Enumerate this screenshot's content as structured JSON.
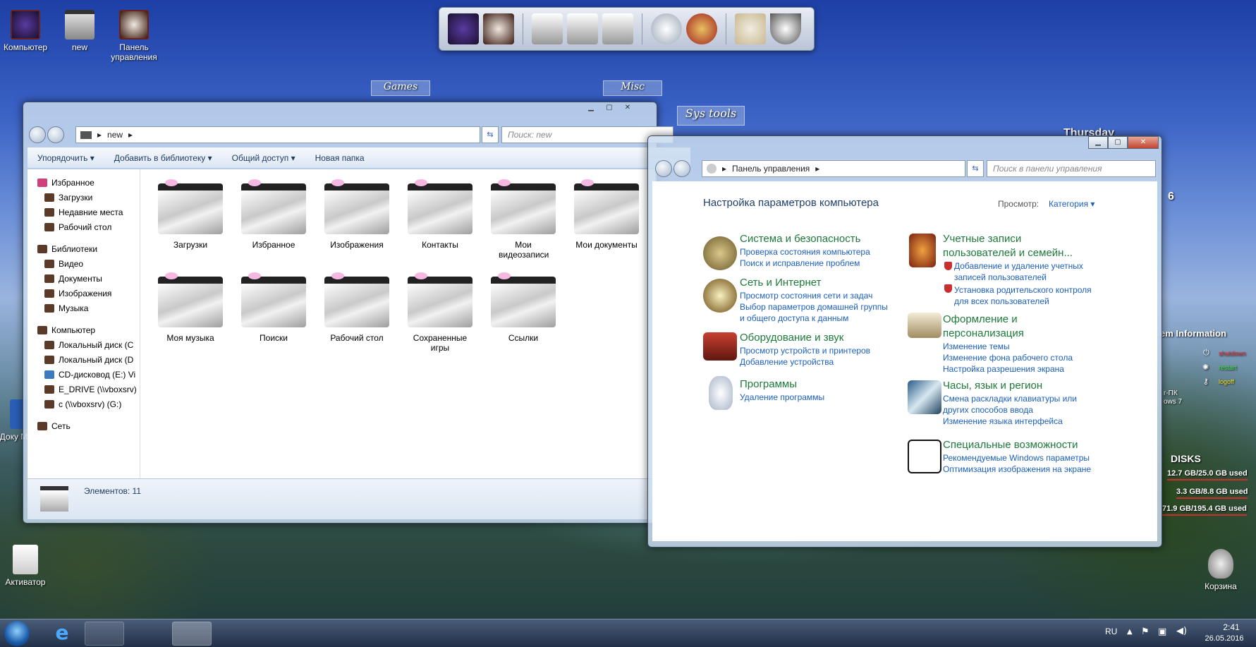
{
  "desktop_icons": [
    {
      "label": "Компьютер"
    },
    {
      "label": "new"
    },
    {
      "label": "Панель управления"
    },
    {
      "label": "Доку Mic"
    },
    {
      "label": "Активатор"
    },
    {
      "label": "Корзина"
    }
  ],
  "fences": {
    "games": "Games",
    "misc": "Misc",
    "sys_tools": "Sys tools"
  },
  "explorer": {
    "address_folder": "new",
    "search_placeholder": "Поиск: new",
    "toolbar": {
      "organize": "Упорядочить ▾",
      "add_library": "Добавить в библиотеку ▾",
      "share": "Общий доступ ▾",
      "new_folder": "Новая папка"
    },
    "nav": {
      "favorites": "Избранное",
      "downloads": "Загрузки",
      "recent": "Недавние места",
      "desktop": "Рабочий стол",
      "libraries": "Библиотеки",
      "video": "Видео",
      "documents": "Документы",
      "images": "Изображения",
      "music": "Музыка",
      "computer": "Компьютер",
      "disk_c": "Локальный диск (C",
      "disk_d": "Локальный диск (D",
      "cd": "CD-дисковод (E:) Vi",
      "edrive": "E_DRIVE (\\\\vboxsrv)",
      "c_share": "c (\\\\vboxsrv) (G:)",
      "network": "Сеть"
    },
    "folders": [
      "Загрузки",
      "Избранное",
      "Изображения",
      "Контакты",
      "Мои видеозаписи",
      "Мои документы",
      "Моя музыка",
      "Поиски",
      "Рабочий стол",
      "Сохраненные игры",
      "Ссылки"
    ],
    "status": "Элементов: 11"
  },
  "control_panel": {
    "address": "Панель управления",
    "search_placeholder": "Поиск в панели управления",
    "title": "Настройка параметров компьютера",
    "view_label": "Просмотр:",
    "view_value": "Категория ▾",
    "left": [
      {
        "head": "Система и безопасность",
        "links": [
          "Проверка состояния компьютера",
          "Поиск и исправление проблем"
        ]
      },
      {
        "head": "Сеть и Интернет",
        "links": [
          "Просмотр состояния сети и задач",
          "Выбор параметров домашней группы",
          "и общего доступа к данным"
        ]
      },
      {
        "head": "Оборудование и звук",
        "links": [
          "Просмотр устройств и принтеров",
          "Добавление устройства"
        ]
      },
      {
        "head": "Программы",
        "links": [
          "Удаление программы"
        ]
      }
    ],
    "right": [
      {
        "head1": "Учетные записи",
        "head2": "пользователей и семейн...",
        "links": [
          "Добавление и удаление учетных",
          "записей пользователей",
          "Установка родительского контроля",
          "для всех пользователей"
        ]
      },
      {
        "head1": "Оформление и",
        "head2": "персонализация",
        "links": [
          "Изменение темы",
          "Изменение фона рабочего стола",
          "Настройка разрешения экрана"
        ]
      },
      {
        "head": "Часы, язык и регион",
        "links": [
          "Смена раскладки клавиатуры или",
          "других способов ввода",
          "Изменение языка интерфейса"
        ]
      },
      {
        "head": "Специальные возможности",
        "links": [
          "Рекомендуемые Windows параметры",
          "Оптимизация изображения на экране"
        ]
      }
    ]
  },
  "widgets": {
    "day": "Thursday",
    "date_partial": "6",
    "sys_info": "em  Information",
    "shutdown": "shutdown",
    "restart": "restart",
    "logoff": "logoff",
    "pc_partial": "r-ПК",
    "os_partial": "ows 7",
    "disks_title": "DISKS",
    "disk1": "12.7 GB/25.0 GB used",
    "disk2": "3.3 GB/8.8 GB used",
    "disk3": "71.9 GB/195.4 GB used"
  },
  "taskbar": {
    "lang": "RU",
    "time": "2:41",
    "date": "26.05.2016"
  }
}
